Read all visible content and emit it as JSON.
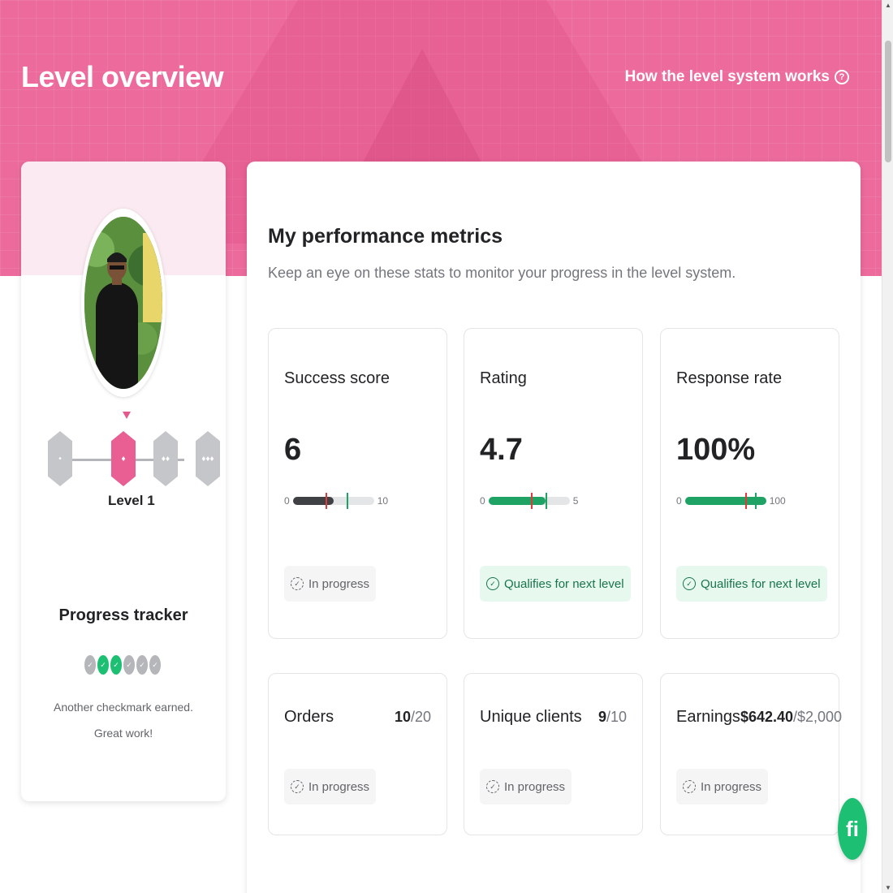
{
  "header": {
    "title": "Level overview",
    "how_link": "How the level system works",
    "help_icon": "?"
  },
  "profile": {
    "avatar_alt": "profile-photo",
    "current_level": "Level 1",
    "level_badges": [
      "•",
      "♦",
      "♦♦",
      "♦♦♦"
    ],
    "active_level_index": 1,
    "tracker_title": "Progress tracker",
    "tracker_states": [
      "pending",
      "done",
      "done",
      "pending",
      "pending",
      "pending"
    ],
    "tracker_message": "Another checkmark earned. Great work!"
  },
  "metrics": {
    "title": "My performance metrics",
    "subtitle": "Keep an eye on these stats to monitor your progress in the level system.",
    "cards": [
      {
        "label": "Success score",
        "value": "6",
        "min": "0",
        "max": "10",
        "fill_fraction": 0.5,
        "fill_color": "dark",
        "status": "In progress",
        "status_type": "progress"
      },
      {
        "label": "Rating",
        "value": "4.7",
        "min": "0",
        "max": "5",
        "fill_fraction": 0.7,
        "fill_color": "green",
        "status": "Qualifies for next level",
        "status_type": "qualify"
      },
      {
        "label": "Response rate",
        "value": "100%",
        "min": "0",
        "max": "100",
        "fill_fraction": 1.0,
        "fill_color": "green",
        "status": "Qualifies for next level",
        "status_type": "qualify"
      }
    ],
    "small_cards": [
      {
        "label": "Orders",
        "current": "10",
        "total": "/20",
        "status": "In progress"
      },
      {
        "label": "Unique clients",
        "current": "9",
        "total": "/10",
        "status": "In progress"
      },
      {
        "label": "Earnings",
        "current": "$642.40",
        "total": "/$2,000",
        "status": "In progress"
      }
    ]
  },
  "colors": {
    "brand_pink": "#ec6b9c",
    "green": "#1dbf73",
    "dark": "#404145"
  },
  "chat_button": "fi"
}
